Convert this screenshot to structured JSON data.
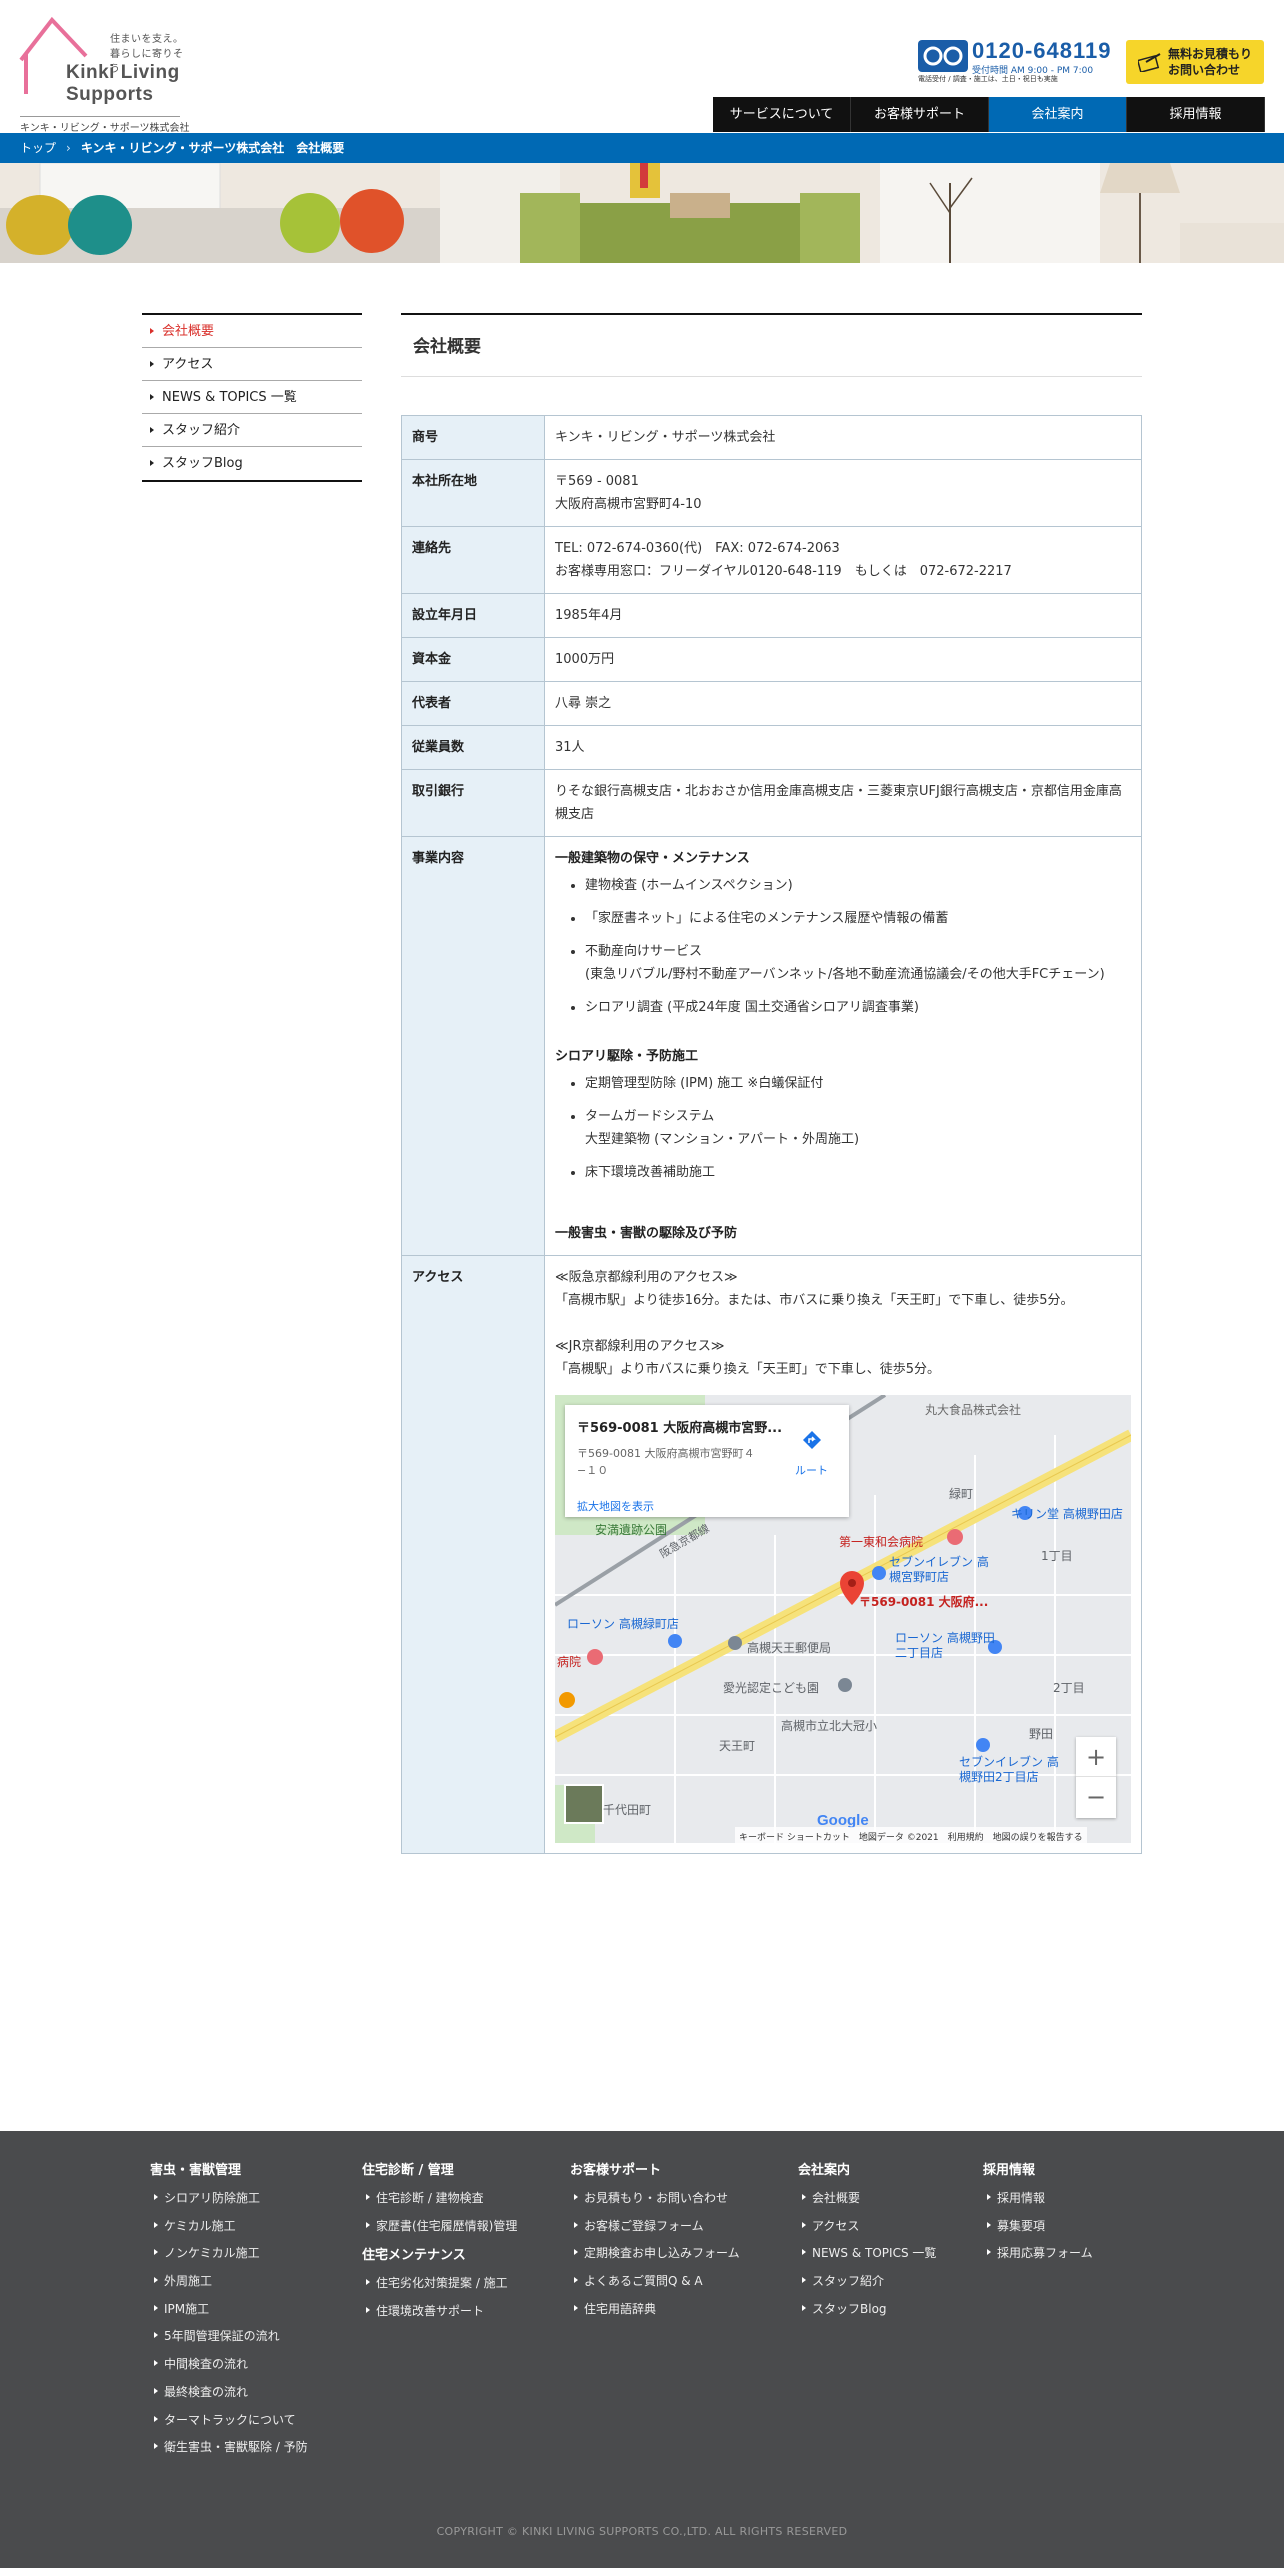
{
  "header": {
    "tagline": "住まいを支え。\n暮らしに寄りそう",
    "brand": "Kinki Living\nSupports",
    "company": "キンキ・リビング・サポーツ株式会社",
    "phone": "0120-648119",
    "phone_hours": "受付時間 AM 9:00 - PM 7:00",
    "phone_note": "電話受付 / 調査・施工は、土日・祝日も実施",
    "quote_button": "無料お見積もり\nお問い合わせ"
  },
  "nav": [
    "サービスについて",
    "お客様サポート",
    "会社案内",
    "採用情報"
  ],
  "nav_active": 2,
  "breadcrumb": {
    "home": "トップ",
    "current": "キンキ・リビング・サポーツ株式会社　会社概要"
  },
  "sidebar": [
    "会社概要",
    "アクセス",
    "NEWS & TOPICS 一覧",
    "スタッフ紹介",
    "スタッフBlog"
  ],
  "page_title": "会社概要",
  "table": [
    {
      "label": "商号",
      "lines": [
        "キンキ・リビング・サポーツ株式会社"
      ]
    },
    {
      "label": "本社所在地",
      "lines": [
        "〒569 - 0081",
        "大阪府高槻市宮野町4-10"
      ]
    },
    {
      "label": "連絡先",
      "lines": [
        "TEL: 072-674-0360(代)　FAX: 072-674-2063",
        "お客様専用窓口：フリーダイヤル0120-648-119　もしくは　072-672-2217"
      ]
    },
    {
      "label": "設立年月日",
      "lines": [
        "1985年4月"
      ]
    },
    {
      "label": "資本金",
      "lines": [
        "1000万円"
      ]
    },
    {
      "label": "代表者",
      "lines": [
        "八尋 崇之"
      ]
    },
    {
      "label": "従業員数",
      "lines": [
        "31人"
      ]
    },
    {
      "label": "取引銀行",
      "lines": [
        "りそな銀行高槻支店・北おおさか信用金庫高槻支店・三菱東京UFJ銀行高槻支店・京都信用金庫高槻支店"
      ]
    }
  ],
  "business": {
    "label": "事業内容",
    "sections": [
      {
        "title": "一般建築物の保守・メンテナンス",
        "items": [
          [
            "建物検査 (ホームインスペクション)"
          ],
          [
            "「家歴書ネット」による住宅のメンテナンス履歴や情報の備蓄"
          ],
          [
            "不動産向けサービス",
            "(東急リバブル/野村不動産アーバンネット/各地不動産流通協議会/その他大手FCチェーン)"
          ],
          [
            "シロアリ調査 (平成24年度 国土交通省シロアリ調査事業)"
          ]
        ]
      },
      {
        "title": "シロアリ駆除・予防施工",
        "items": [
          [
            "定期管理型防除 (IPM) 施工 ※白蟻保証付"
          ],
          [
            "タームガードシステム",
            "大型建築物 (マンション・アパート・外周施工)"
          ],
          [
            "床下環境改善補助施工"
          ]
        ]
      },
      {
        "title": "一般害虫・害獣の駆除及び予防",
        "items": []
      }
    ]
  },
  "access": {
    "label": "アクセス",
    "hankyu_title": "≪阪急京都線利用のアクセス≫",
    "hankyu_text": "「高槻市駅」より徒歩16分。または、市バスに乗り換え「天王町」で下車し、徒歩5分。",
    "jr_title": "≪JR京都線利用のアクセス≫",
    "jr_text": "「高槻駅」より市バスに乗り換え「天王町」で下車し、徒歩5分。"
  },
  "map": {
    "card_title": "〒569-0081 大阪府高槻市宮野...",
    "card_address": "〒569-0081 大阪府高槻市宮野町４−１０",
    "card_link": "拡大地図を表示",
    "route_label": "ルート",
    "pin_label": "〒569-0081 大阪府...",
    "labels": [
      "丸大食品株式会社",
      "安満遺跡公園",
      "第一東和会病院",
      "セブンイレブン 高槻宮野町店",
      "キリン堂 高槻野田店",
      "ローソン 高槻緑町店",
      "高槻天王郵便局",
      "ローソン 高槻野田二丁目店",
      "愛光認定こども園",
      "高槻市立北大冠小",
      "天王町",
      "セブンイレブン 高槻野田2丁目店",
      "千代田町",
      "緑町",
      "1丁目",
      "2丁目",
      "野田",
      "阪急京都線",
      "病院"
    ],
    "footer": "キーボード ショートカット　地図データ ©2021　利用規約　地図の誤りを報告する",
    "google": "Google",
    "zoom_in": "+",
    "zoom_out": "−"
  },
  "footer": {
    "columns": [
      {
        "heading": "害虫・害獣管理",
        "items": [
          "シロアリ防除施工",
          "ケミカル施工",
          "ノンケミカル施工",
          "外周施工",
          "IPM施工",
          "5年間管理保証の流れ",
          "中間検査の流れ",
          "最終検査の流れ",
          "ターマトラックについて",
          "衛生害虫・害獣駆除 / 予防"
        ]
      },
      {
        "heading": "住宅診断 / 管理",
        "items": [
          "住宅診断 / 建物検査",
          "家歴書(住宅履歴情報)管理"
        ],
        "heading2": "住宅メンテナンス",
        "items2": [
          "住宅劣化対策提案 / 施工",
          "住環境改善サポート"
        ]
      },
      {
        "heading": "お客様サポート",
        "items": [
          "お見積もり・お問い合わせ",
          "お客様ご登録フォーム",
          "定期検査お申し込みフォーム",
          "よくあるご質問Q & A",
          "住宅用語辞典"
        ]
      },
      {
        "heading": "会社案内",
        "items": [
          "会社概要",
          "アクセス",
          "NEWS & TOPICS 一覧",
          "スタッフ紹介",
          "スタッフBlog"
        ]
      },
      {
        "heading": "採用情報",
        "items": [
          "採用情報",
          "募集要項",
          "採用応募フォーム"
        ]
      }
    ],
    "copyright": "COPYRIGHT © KINKI LIVING SUPPORTS CO.,LTD. ALL RIGHTS RESERVED"
  },
  "colors": {
    "brand_blue": "#0069b4",
    "accent_red": "#d9302b",
    "cta_yellow": "#f6d52a",
    "logo_pink": "#e8709a"
  }
}
